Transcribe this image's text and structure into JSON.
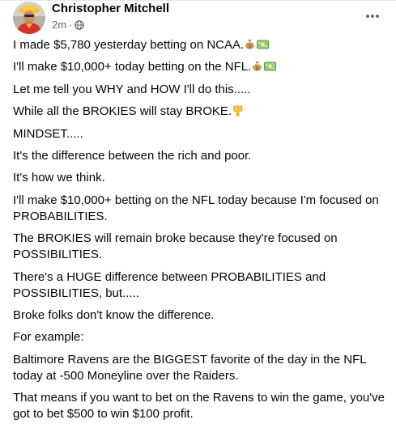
{
  "post": {
    "author_name": "Christopher Mitchell",
    "timestamp": "2m",
    "separator": "·",
    "privacy_icon": "globe-icon",
    "more_icon": "more-options-icon",
    "paragraphs": [
      "I made $5,780 yesterday betting on NCAA.",
      "I'll make $10,000+ today betting on the NFL.",
      "Let me tell you WHY and HOW I'll do this.....",
      "While all the BROKIES will stay BROKE.",
      "MINDSET.....",
      "It's the difference between the rich and poor.",
      "It's how we think.",
      "I'll make $10,000+ betting on the NFL today because I'm focused on PROBABILITIES.",
      "The BROKIES will remain broke because they're focused on POSSIBILITIES.",
      "There's a HUGE difference between PROBABILITIES and POSSIBILITIES, but.....",
      "Broke folks don't know the difference.",
      "For example:",
      "Baltimore Ravens are the BIGGEST favorite of the day in the NFL today at -500 Moneyline over the Raiders.",
      "That means if you want to bet on the Ravens to win the game, you've got to bet $500 to win $100 profit."
    ],
    "emoji": {
      "money_bag": "money-bag-icon",
      "dollar_banknote": "dollar-banknote-icon",
      "pointing_down": "backhand-index-pointing-down-icon"
    }
  }
}
